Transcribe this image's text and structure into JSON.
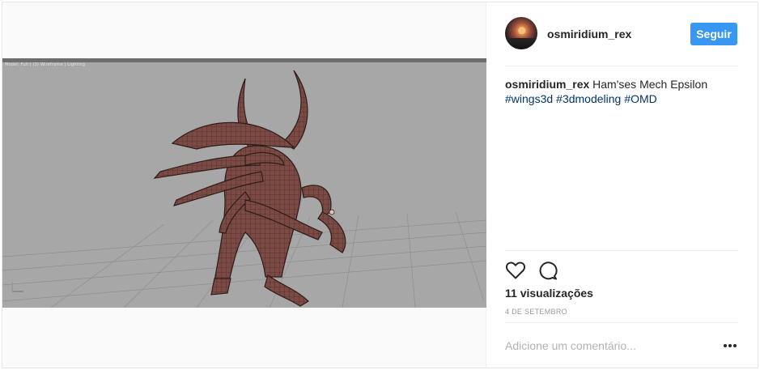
{
  "post": {
    "media": {
      "viewport_label": "Model: Full | (3) Wireframe | Lighting"
    },
    "header": {
      "username": "osmiridium_rex",
      "follow_label": "Seguir"
    },
    "caption": {
      "username": "osmiridium_rex",
      "text": "Ham'ses Mech Epsilon",
      "hashtags": [
        "#wings3d",
        "#3dmodeling",
        "#OMD"
      ]
    },
    "actions": {
      "like_icon": "heart-outline-icon",
      "comment_icon": "speech-bubble-icon"
    },
    "views": "11 visualizações",
    "date": "4 DE SETEMBRO",
    "comment": {
      "placeholder": "Adicione um comentário...",
      "more_icon": "more-dots-icon"
    },
    "colors": {
      "accent": "#3897f0",
      "hashtag": "#003569",
      "viewport_bg": "#a7a7a7",
      "model": "#7a4a44"
    }
  }
}
